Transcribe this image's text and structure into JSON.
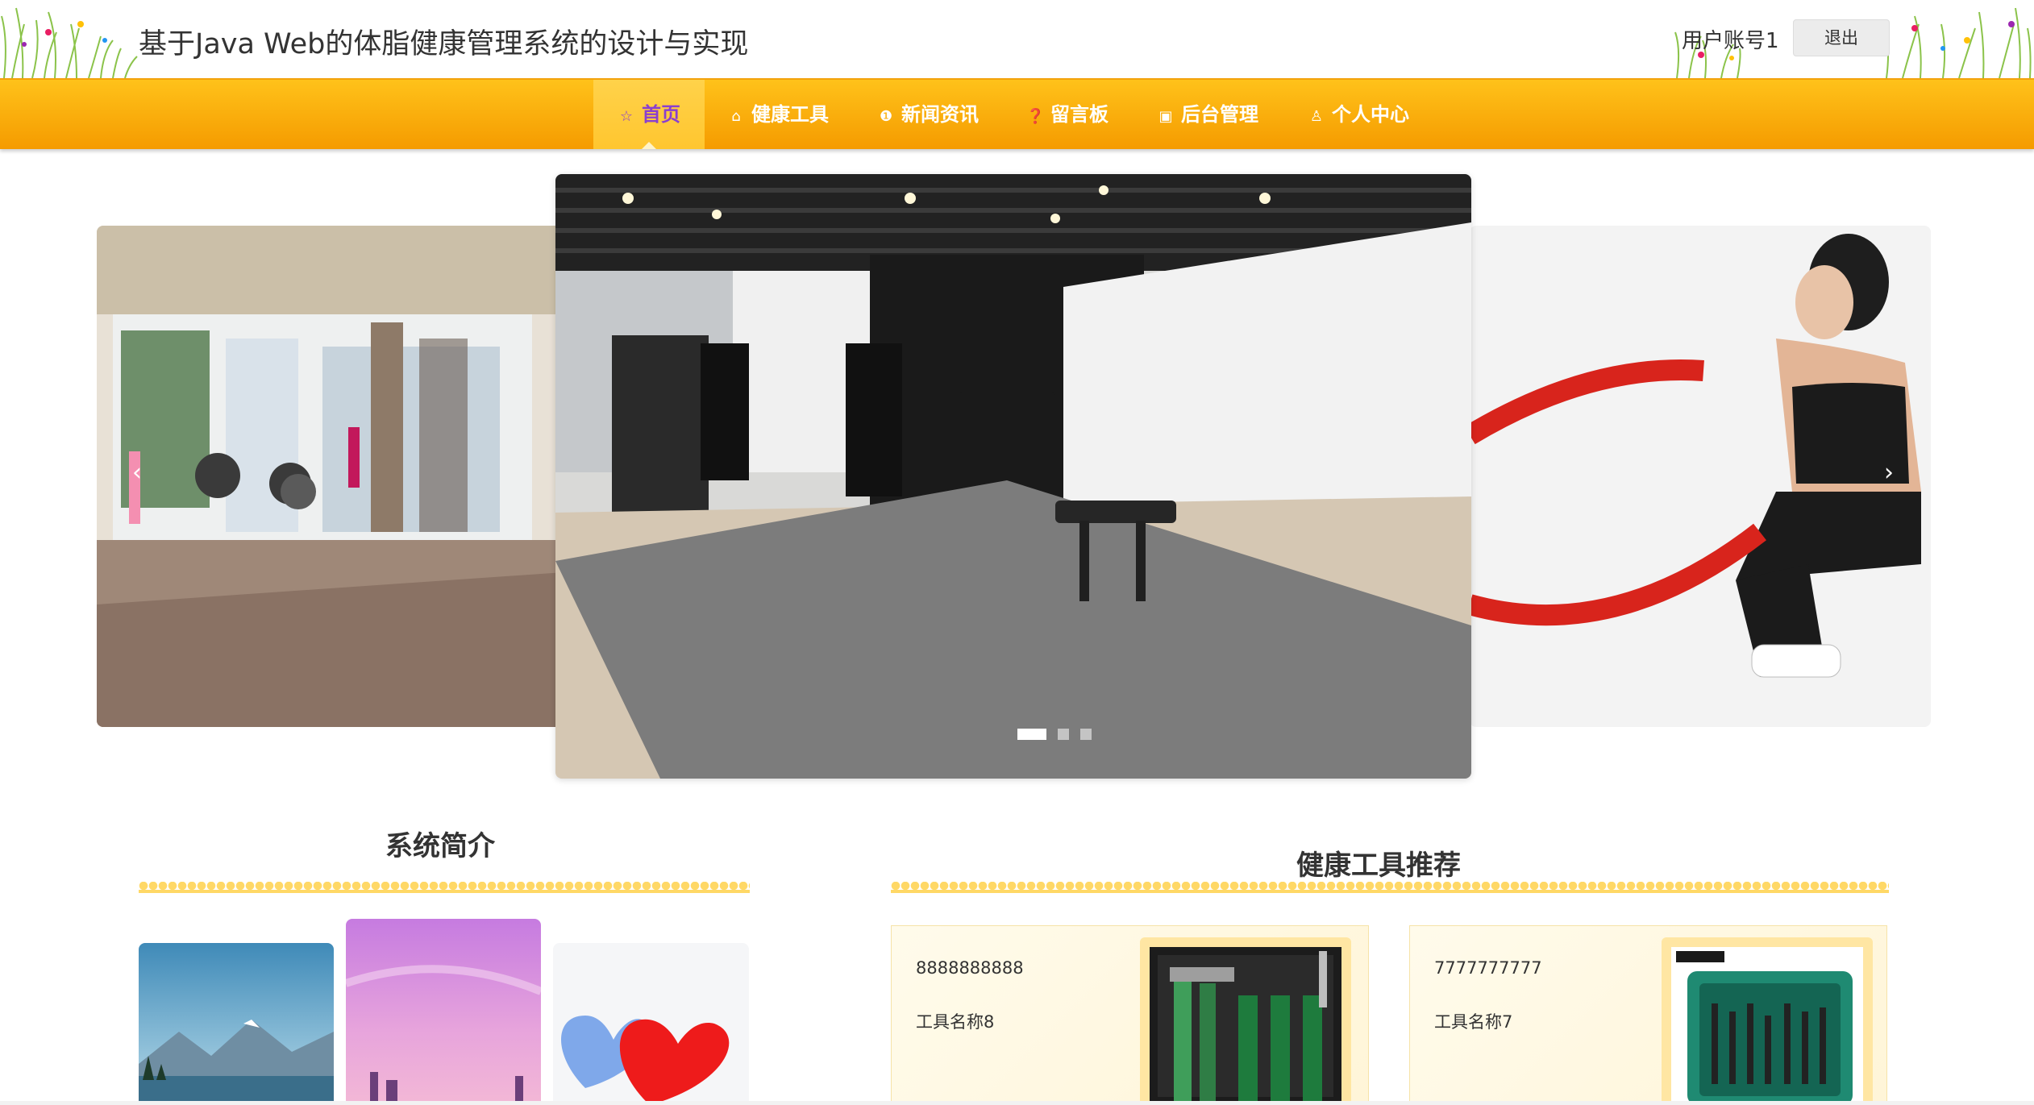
{
  "header": {
    "title": "基于Java Web的体脂健康管理系统的设计与实现",
    "username": "用户账号1",
    "logout_label": "退出"
  },
  "nav": {
    "items": [
      {
        "label": "首页",
        "icon": "star-outline-icon",
        "active": true
      },
      {
        "label": "健康工具",
        "icon": "bag-icon"
      },
      {
        "label": "新闻资讯",
        "icon": "info-circle-icon"
      },
      {
        "label": "留言板",
        "icon": "question-circle-icon"
      },
      {
        "label": "后台管理",
        "icon": "briefcase-icon"
      },
      {
        "label": "个人中心",
        "icon": "user-icon"
      }
    ],
    "colors": {
      "bar": "#ffb300",
      "active_text": "#8a3fd0"
    }
  },
  "carousel": {
    "slides": [
      "gym-interior-image",
      "fitness-equipment-image",
      "battle-rope-workout-image"
    ],
    "active_index": 0,
    "dot_count": 3
  },
  "intro": {
    "title": "系统简介",
    "images": [
      "lake-mountain-image",
      "purple-sky-image",
      "watercolor-hearts-image"
    ]
  },
  "tools": {
    "title": "健康工具推荐",
    "cards": [
      {
        "number": "8888888888",
        "name": "工具名称8",
        "image": "tool-kit-black-image"
      },
      {
        "number": "7777777777",
        "name": "工具名称7",
        "image": "tool-kit-green-image"
      }
    ]
  }
}
